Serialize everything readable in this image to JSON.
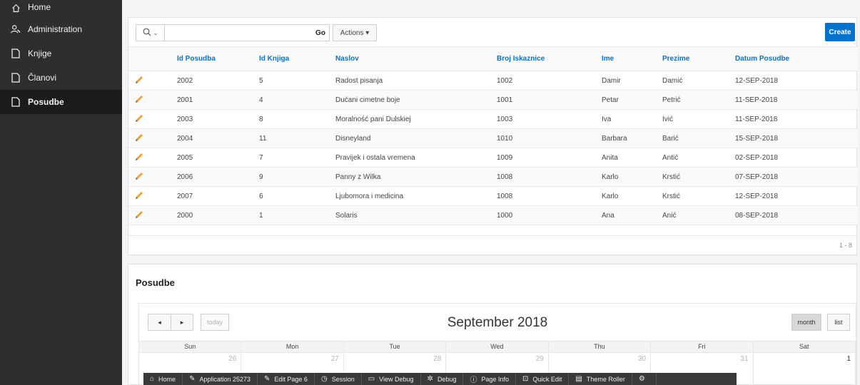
{
  "sidebar": {
    "items": [
      {
        "label": "Home",
        "icon": "home-icon"
      },
      {
        "label": "Administration",
        "icon": "user-wrench-icon"
      },
      {
        "label": "Knjige",
        "icon": "file-icon"
      },
      {
        "label": "Članovi",
        "icon": "file-icon"
      },
      {
        "label": "Posudbe",
        "icon": "file-icon",
        "active": true
      }
    ]
  },
  "toolbar": {
    "search_placeholder": "",
    "go_label": "Go",
    "actions_label": "Actions ▾",
    "create_label": "Create"
  },
  "report": {
    "columns": [
      "Id Posudba",
      "Id Knjiga",
      "Naslov",
      "Broj Iskaznice",
      "Ime",
      "Prezime",
      "Datum Posudbe"
    ],
    "rows": [
      [
        "2002",
        "5",
        "Radost pisanja",
        "1002",
        "Damir",
        "Damić",
        "12-SEP-2018"
      ],
      [
        "2001",
        "4",
        "Dućani cimetne boje",
        "1001",
        "Petar",
        "Petrić",
        "11-SEP-2018"
      ],
      [
        "2003",
        "8",
        "Moralność pani Dulskiej",
        "1003",
        "Iva",
        "Ivić",
        "11-SEP-2018"
      ],
      [
        "2004",
        "11",
        "Disneyland",
        "1010",
        "Barbara",
        "Barić",
        "15-SEP-2018"
      ],
      [
        "2005",
        "7",
        "Pravijek i ostala vremena",
        "1009",
        "Anita",
        "Antić",
        "02-SEP-2018"
      ],
      [
        "2006",
        "9",
        "Panny z Wilka",
        "1008",
        "Karlo",
        "Krstić",
        "07-SEP-2018"
      ],
      [
        "2007",
        "6",
        "Ljubomora i medicina",
        "1008",
        "Karlo",
        "Krstić",
        "12-SEP-2018"
      ],
      [
        "2000",
        "1",
        "Solaris",
        "1000",
        "Ana",
        "Anić",
        "08-SEP-2018"
      ]
    ],
    "pagination": "1 - 8"
  },
  "calendar": {
    "region_title": "Posudbe",
    "prev_label": "◂",
    "next_label": "▸",
    "today_label": "today",
    "month_title": "September 2018",
    "month_label": "month",
    "list_label": "list",
    "weekdays": [
      "Sun",
      "Mon",
      "Tue",
      "Wed",
      "Thu",
      "Fri",
      "Sat"
    ],
    "first_row": [
      "26",
      "27",
      "28",
      "29",
      "30",
      "31",
      "1"
    ]
  },
  "devbar": {
    "items": [
      {
        "label": "Home",
        "icon": "⌂"
      },
      {
        "label": "Application 25273",
        "icon": "✎"
      },
      {
        "label": "Edit Page 6",
        "icon": "✎"
      },
      {
        "label": "Session",
        "icon": "◷"
      },
      {
        "label": "View Debug",
        "icon": "▭"
      },
      {
        "label": "Debug",
        "icon": "✲"
      },
      {
        "label": "Page Info",
        "icon": "ⓘ"
      },
      {
        "label": "Quick Edit",
        "icon": "⊡"
      },
      {
        "label": "Theme Roller",
        "icon": "▤"
      },
      {
        "label": "",
        "icon": "⚙"
      }
    ]
  },
  "colors": {
    "accent": "#0572ce",
    "sidebar_bg": "#2e2e2e",
    "pencil": "#e8a33c"
  }
}
